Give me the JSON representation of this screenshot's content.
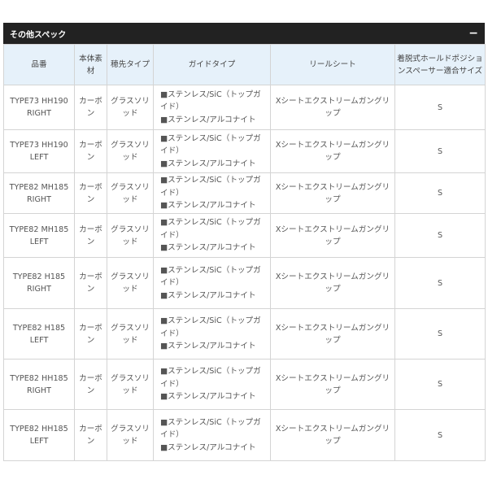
{
  "panel": {
    "title": "その他スペック",
    "toggle": "−"
  },
  "table": {
    "headers": [
      "品番",
      "本体素材",
      "穂先タイプ",
      "ガイドタイプ",
      "リールシート",
      "着脱式ホールドポジションスペーサー適合サイズ"
    ],
    "rows": [
      {
        "model": "TYPE73 HH190 RIGHT",
        "material": "カーボン",
        "tip": "グラスソリッド",
        "guide": [
          "■ステンレス/SiC（トップガイド）",
          "■ステンレス/アルコナイト"
        ],
        "reel_seat": "Xシートエクストリームガングリップ",
        "spacer": "S"
      },
      {
        "model": "TYPE73 HH190 LEFT",
        "material": "カーボン",
        "tip": "グラスソリッド",
        "guide": [
          "■ステンレス/SiC（トップガイド）",
          "■ステンレス/アルコナイト"
        ],
        "reel_seat": "Xシートエクストリームガングリップ",
        "spacer": "S"
      },
      {
        "model": "TYPE82 MH185 RIGHT",
        "material": "カーボン",
        "tip": "グラスソリッド",
        "guide": [
          "■ステンレス/SiC（トップガイド）",
          "■ステンレス/アルコナイト"
        ],
        "reel_seat": "Xシートエクストリームガングリップ",
        "spacer": "S"
      },
      {
        "model": "TYPE82 MH185 LEFT",
        "material": "カーボン",
        "tip": "グラスソリッド",
        "guide": [
          "■ステンレス/SiC（トップガイド）",
          "■ステンレス/アルコナイト"
        ],
        "reel_seat": "Xシートエクストリームガングリップ",
        "spacer": "S"
      },
      {
        "model": "TYPE82 H185 RIGHT",
        "material": "カーボン",
        "tip": "グラスソリッド",
        "guide": [
          "■ステンレス/SiC（トップガイド）",
          "■ステンレス/アルコナイト"
        ],
        "reel_seat": "Xシートエクストリームガングリップ",
        "spacer": "S"
      },
      {
        "model": "TYPE82 H185 LEFT",
        "material": "カーボン",
        "tip": "グラスソリッド",
        "guide": [
          "■ステンレス/SiC（トップガイド）",
          "■ステンレス/アルコナイト"
        ],
        "reel_seat": "Xシートエクストリームガングリップ",
        "spacer": "S"
      },
      {
        "model": "TYPE82 HH185 RIGHT",
        "material": "カーボン",
        "tip": "グラスソリッド",
        "guide": [
          "■ステンレス/SiC（トップガイド）",
          "■ステンレス/アルコナイト"
        ],
        "reel_seat": "Xシートエクストリームガングリップ",
        "spacer": "S"
      },
      {
        "model": "TYPE82 HH185 LEFT",
        "material": "カーボン",
        "tip": "グラスソリッド",
        "guide": [
          "■ステンレス/SiC（トップガイド）",
          "■ステンレス/アルコナイト"
        ],
        "reel_seat": "Xシートエクストリームガングリップ",
        "spacer": "S"
      }
    ]
  }
}
